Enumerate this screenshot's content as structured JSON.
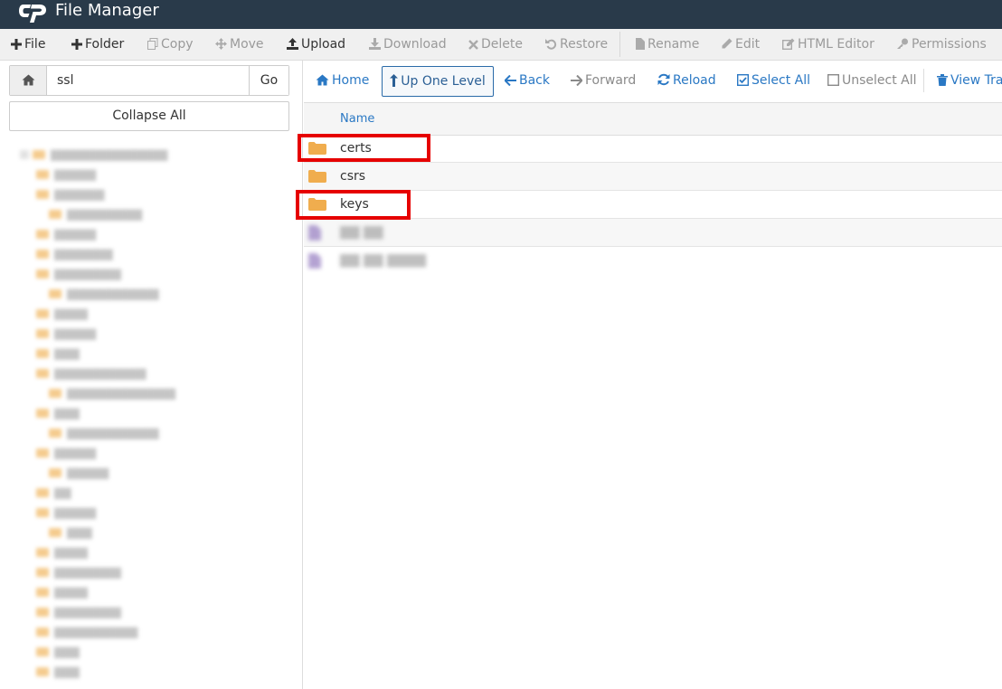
{
  "header": {
    "title": "File Manager"
  },
  "toolbar": {
    "file": "File",
    "folder": "Folder",
    "copy": "Copy",
    "move": "Move",
    "upload": "Upload",
    "download": "Download",
    "delete": "Delete",
    "restore": "Restore",
    "rename": "Rename",
    "edit": "Edit",
    "html_editor": "HTML Editor",
    "permissions": "Permissions"
  },
  "sidebar": {
    "path_value": "ssl",
    "go_label": "Go",
    "collapse_label": "Collapse All"
  },
  "nav": {
    "home": "Home",
    "up_one_level": "Up One Level",
    "back": "Back",
    "forward": "Forward",
    "reload": "Reload",
    "select_all": "Select All",
    "unselect_all": "Unselect All",
    "view_trash": "View Trash"
  },
  "table": {
    "name_header": "Name",
    "rows": [
      {
        "name": "certs",
        "type": "folder",
        "highlighted": true
      },
      {
        "name": "csrs",
        "type": "folder",
        "highlighted": false
      },
      {
        "name": "keys",
        "type": "folder",
        "highlighted": true
      }
    ]
  },
  "colors": {
    "header_bg": "#293a4a",
    "link": "#2a78c4",
    "folder": "#f0ad4e",
    "highlight": "#e60000"
  }
}
